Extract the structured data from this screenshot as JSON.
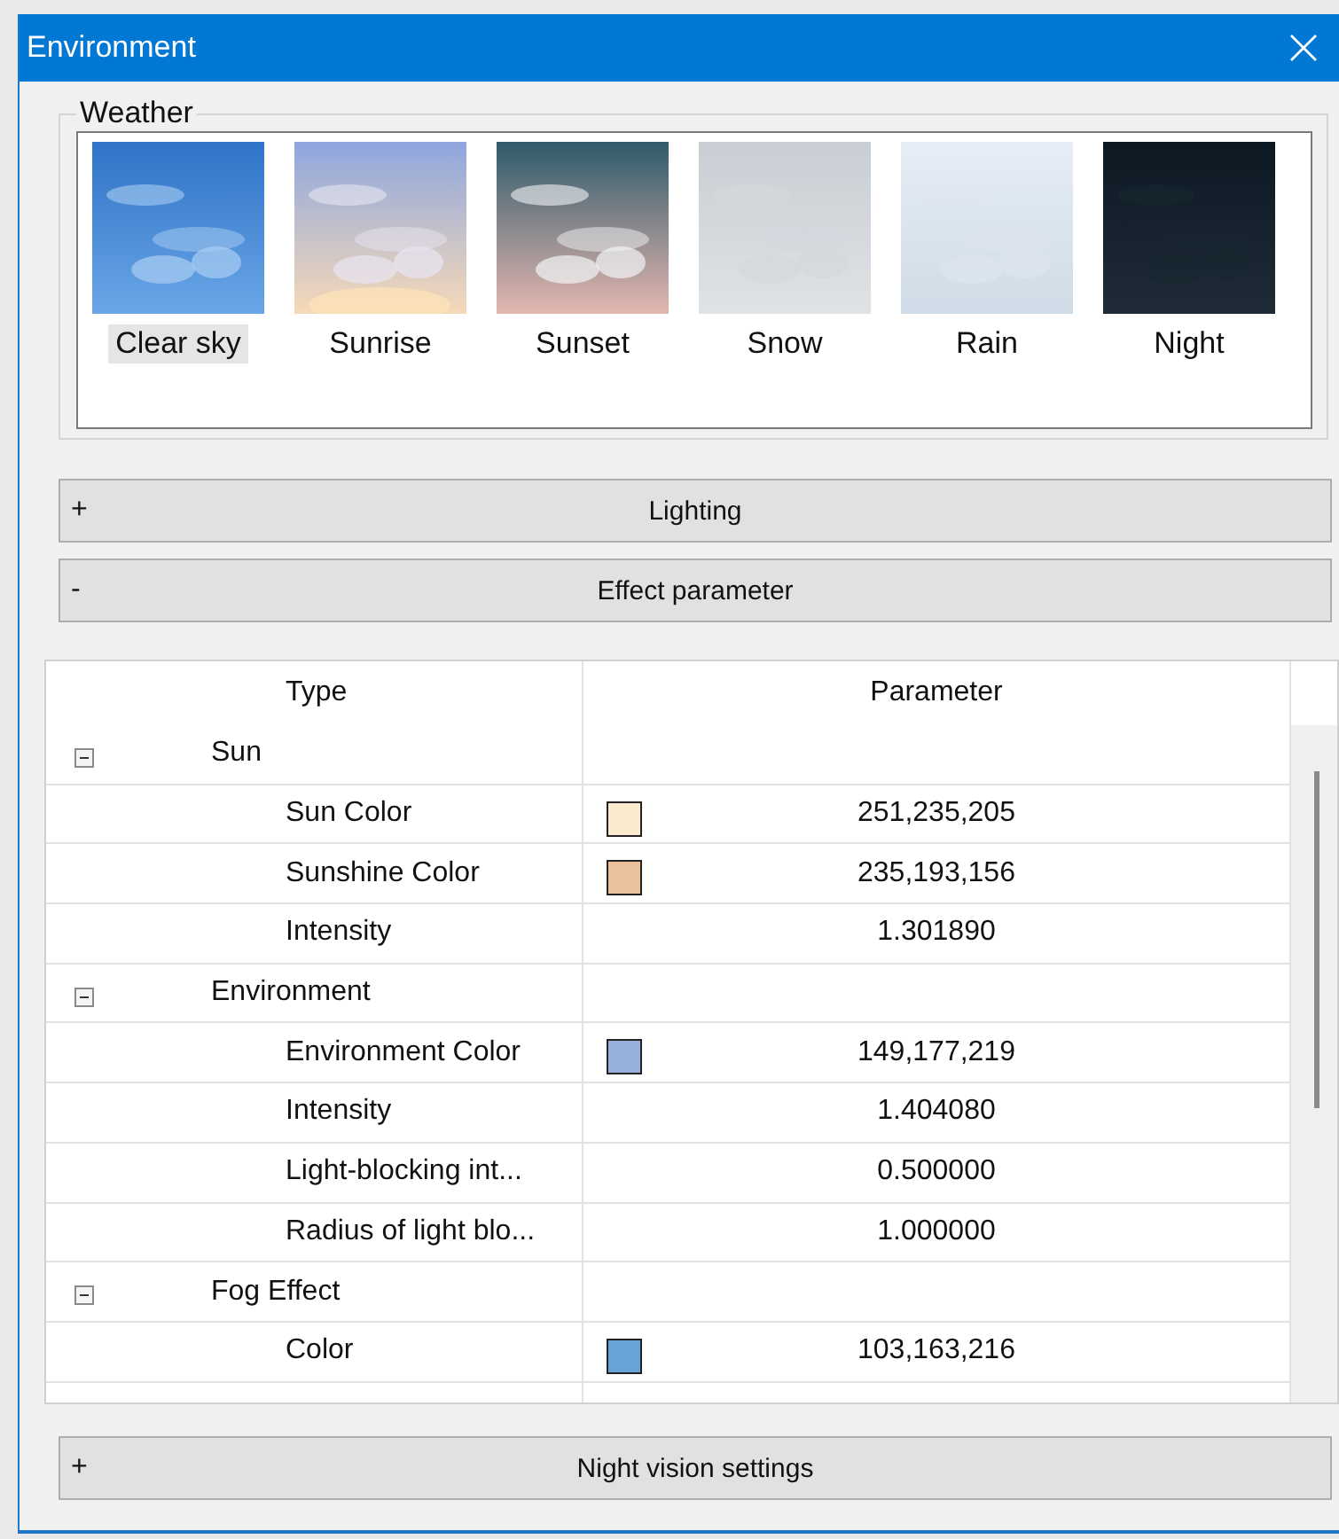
{
  "window": {
    "title": "Environment"
  },
  "weather": {
    "title": "Weather",
    "items": [
      {
        "label": "Clear sky",
        "selected": true
      },
      {
        "label": "Sunrise",
        "selected": false
      },
      {
        "label": "Sunset",
        "selected": false
      },
      {
        "label": "Snow",
        "selected": false
      },
      {
        "label": "Rain",
        "selected": false
      },
      {
        "label": "Night",
        "selected": false
      }
    ]
  },
  "sections_top": [
    {
      "sign": "+",
      "label": "Lighting"
    },
    {
      "sign": "-",
      "label": "Effect parameter"
    }
  ],
  "table": {
    "columns": [
      "Type",
      "Parameter"
    ],
    "groups": [
      {
        "name": "Sun",
        "expanded": true,
        "children": [
          {
            "name": "Sun Color",
            "value": "251,235,205",
            "color": "#fbebcd"
          },
          {
            "name": "Sunshine Color",
            "value": "235,193,156",
            "color": "#ebc19c"
          },
          {
            "name": "Intensity",
            "value": "1.301890"
          }
        ]
      },
      {
        "name": "Environment",
        "expanded": true,
        "children": [
          {
            "name": "Environment Color",
            "value": "149,177,219",
            "color": "#95b1db"
          },
          {
            "name": "Intensity",
            "value": "1.404080"
          },
          {
            "name": "Light-blocking int...",
            "value": "0.500000"
          },
          {
            "name": "Radius of light blo...",
            "value": "1.000000"
          }
        ]
      },
      {
        "name": "Fog Effect",
        "expanded": true,
        "children": [
          {
            "name": "Color",
            "value": "103,163,216",
            "color": "#67a3d8"
          }
        ]
      }
    ]
  },
  "sections_bottom": [
    {
      "sign": "+",
      "label": "Night vision settings"
    }
  ]
}
